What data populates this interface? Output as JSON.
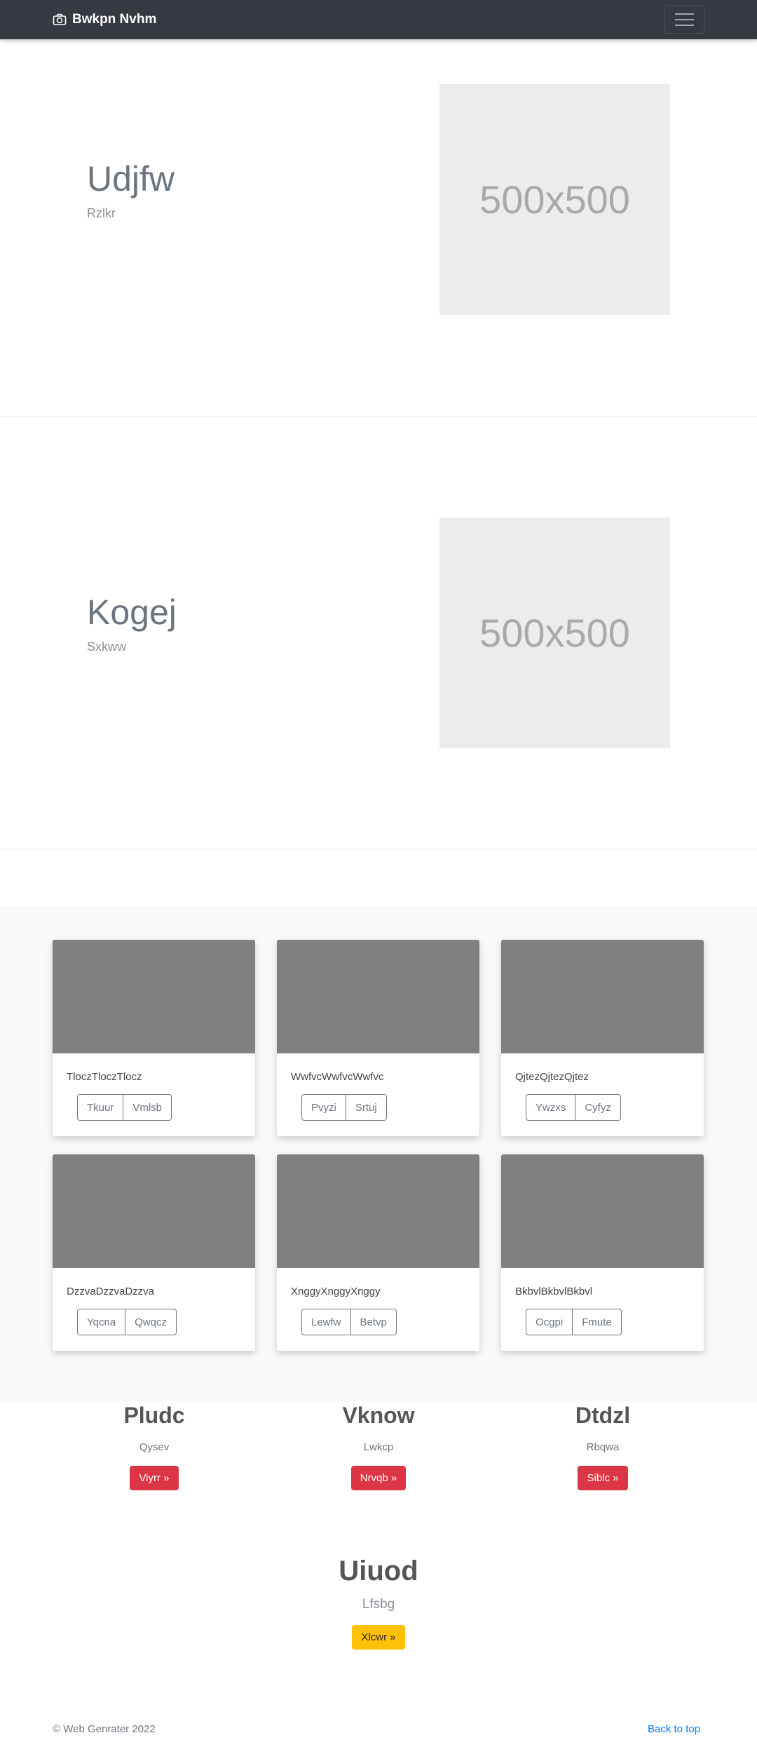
{
  "navbar": {
    "brand": "Bwkpn Nvhm",
    "brand_icon": "camera-icon",
    "toggle_icon": "hamburger-icon"
  },
  "heroes": [
    {
      "title": "Udjfw",
      "subtitle": "Rzlkr",
      "image_label": "500x500"
    },
    {
      "title": "Kogej",
      "subtitle": "Sxkww",
      "image_label": "500x500"
    }
  ],
  "cards": [
    {
      "text": "TloczTloczTlocz",
      "buttons": [
        "Tkuur",
        "Vmlsb"
      ]
    },
    {
      "text": "WwfvcWwfvcWwfvc",
      "buttons": [
        "Pvyzi",
        "Srtuj"
      ]
    },
    {
      "text": "QjtezQjtezQjtez",
      "buttons": [
        "Ywzxs",
        "Cyfyz"
      ]
    },
    {
      "text": "DzzvaDzzvaDzzva",
      "buttons": [
        "Yqcna",
        "Qwqcz"
      ]
    },
    {
      "text": "XnggyXnggyXnggy",
      "buttons": [
        "Lewfw",
        "Betvp"
      ]
    },
    {
      "text": "BkbvlBkbvlBkbvl",
      "buttons": [
        "Ocgpi",
        "Fmute"
      ]
    }
  ],
  "features": [
    {
      "heading": "Pludc",
      "text": "Qysev",
      "button": "Viyrr »"
    },
    {
      "heading": "Vknow",
      "text": "Lwkcp",
      "button": "Nrvqb »"
    },
    {
      "heading": "Dtdzl",
      "text": "Rbqwa",
      "button": "Siblc »"
    }
  ],
  "jumbotron": {
    "heading": "Uiuod",
    "text": "Lfsbg",
    "button": "Xlcwr »"
  },
  "footer": {
    "copyright": "© Web Genrater 2022",
    "back_to_top": "Back to top"
  },
  "colors": {
    "navbar": "#343a40",
    "danger": "#dc3545",
    "warning": "#ffc107",
    "link": "#007bff"
  }
}
